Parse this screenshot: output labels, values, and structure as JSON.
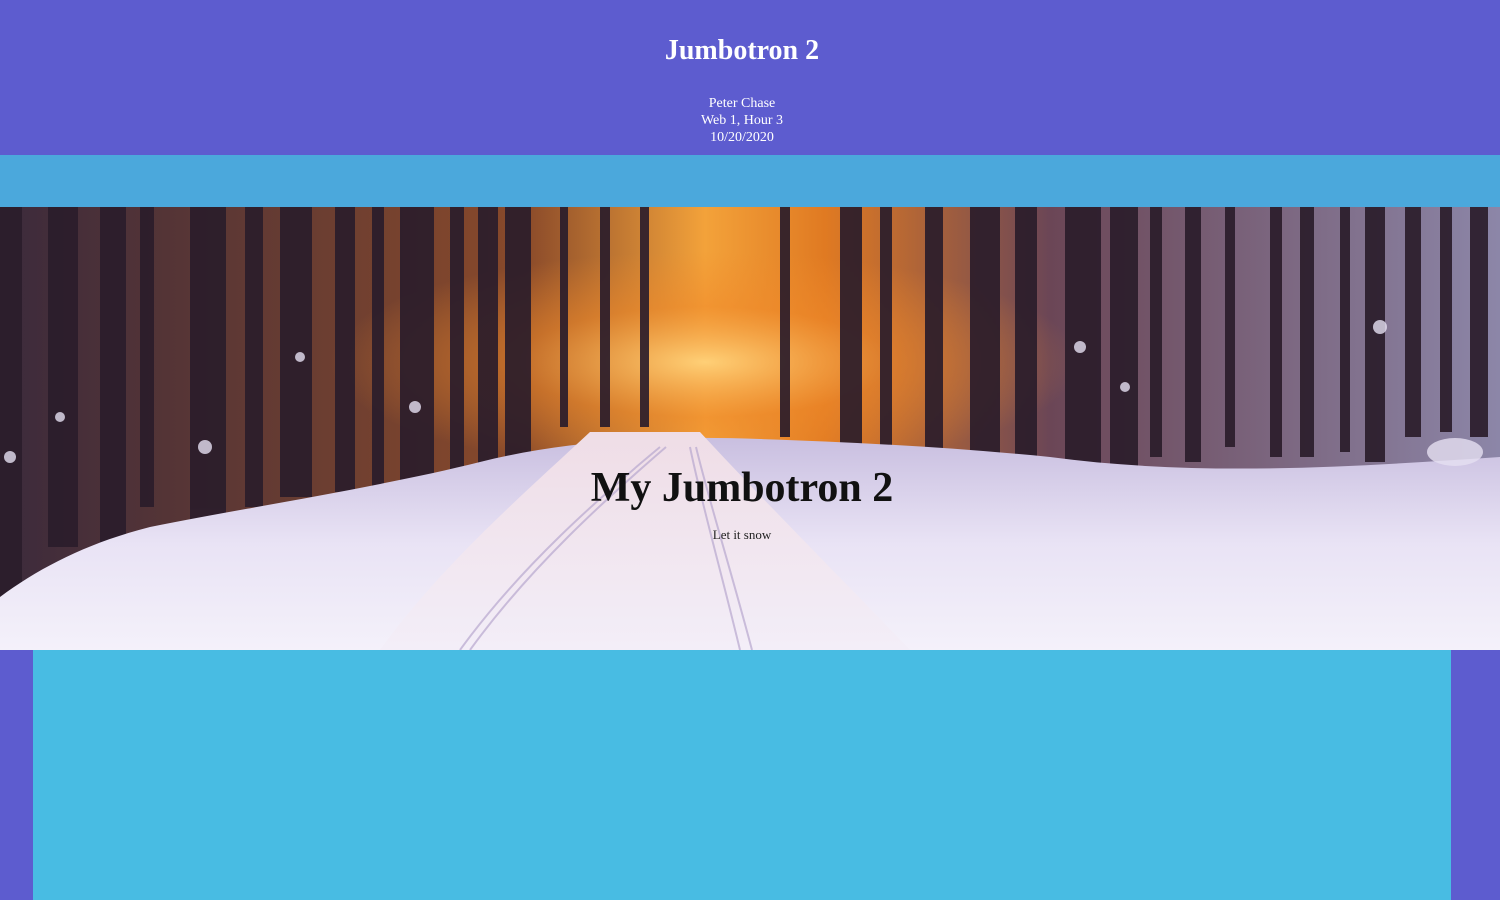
{
  "header": {
    "title": "Jumbotron 2",
    "author": "Peter Chase",
    "course": "Web 1, Hour 3",
    "date": "10/20/2020"
  },
  "jumbotron": {
    "heading": "My Jumbotron 2",
    "subtitle": "Let it snow",
    "background_image": "snowy-forest-path-sunset"
  },
  "colors": {
    "header_bg": "#5d5ccf",
    "band_bg": "#4ba8dc",
    "content_bg": "#48bce3",
    "side_bg": "#5d5ccf"
  }
}
